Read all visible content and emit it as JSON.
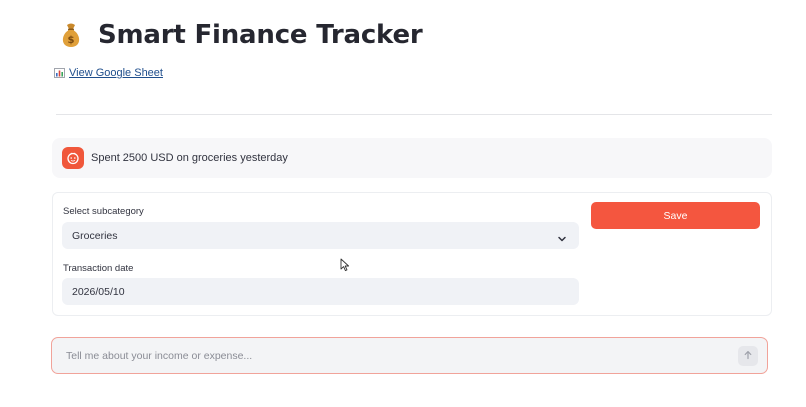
{
  "header": {
    "title": "Smart Finance Tracker",
    "title_icon": "money-bag-icon",
    "sheet_link_icon": "bar-chart-icon",
    "sheet_link_label": "View Google Sheet"
  },
  "chat": {
    "message_avatar_icon": "user-avatar-icon",
    "message_text": "Spent 2500 USD on groceries yesterday",
    "input_placeholder": "Tell me about your income or expense...",
    "send_icon": "arrow-up-icon"
  },
  "form": {
    "subcategory_label": "Select subcategory",
    "subcategory_value": "Groceries",
    "date_label": "Transaction date",
    "date_value": "2026/05/10",
    "save_label": "Save"
  },
  "colors": {
    "accent": "#f4563f",
    "input_background": "#f0f2f6",
    "link": "#1f4e8c"
  }
}
